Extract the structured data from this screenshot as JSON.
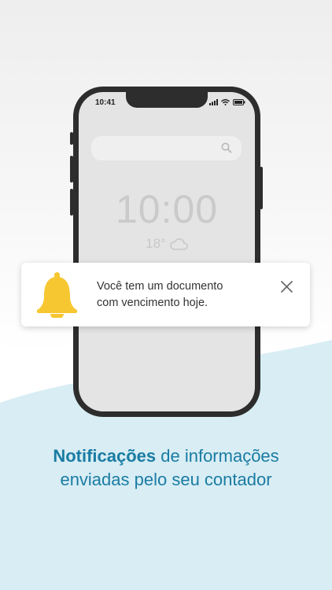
{
  "phone": {
    "status_time": "10:41",
    "clock": "10:00",
    "temperature": "18°",
    "weather_icon": "cloud-icon"
  },
  "notification": {
    "message_line1": "Você tem um documento",
    "message_line2": "com vencimento hoje.",
    "icon": "bell-icon"
  },
  "caption": {
    "highlight": "Notificações",
    "rest_line1": " de informações",
    "line2": "enviadas pelo seu contador"
  },
  "colors": {
    "accent": "#1a7ca3",
    "wave": "#d8edf4",
    "bell": "#f6c731"
  }
}
